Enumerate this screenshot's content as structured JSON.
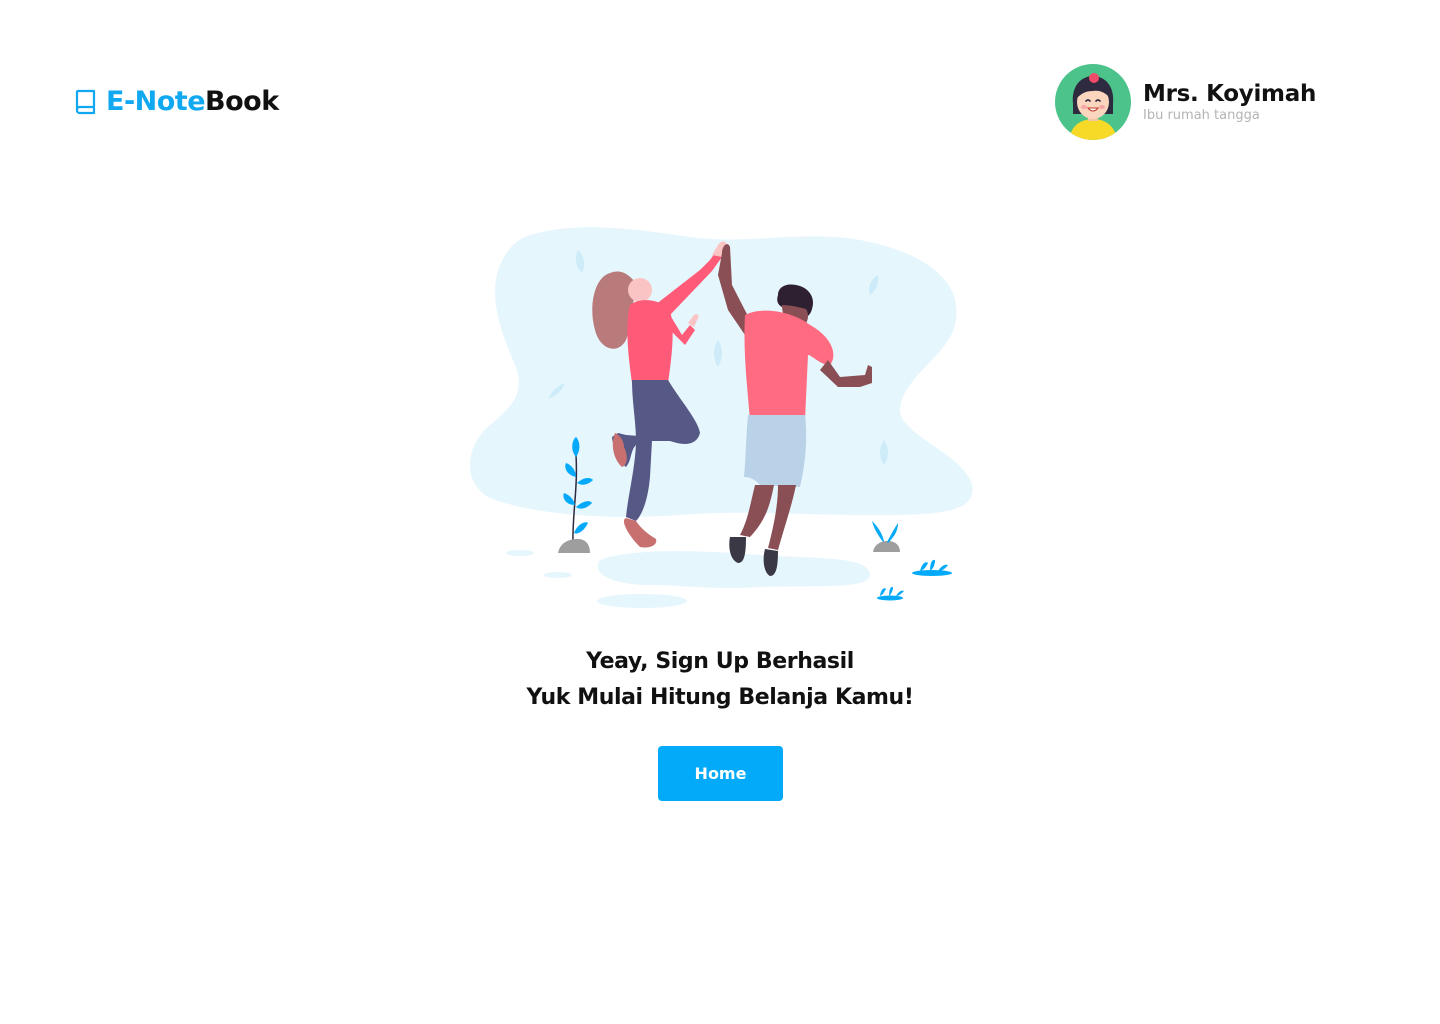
{
  "header": {
    "logo": {
      "icon": "book-icon",
      "text_part_1": "E-Note",
      "text_part_2": "Book"
    },
    "profile": {
      "name": "Mrs. Koyimah",
      "role": "Ibu rumah tangga",
      "avatar_icon": "avatar-woman-icon"
    }
  },
  "main": {
    "illustration": "high-five-people-illustration",
    "message_line_1": "Yeay, Sign Up Berhasil",
    "message_line_2": "Yuk Mulai Hitung Belanja Kamu!",
    "home_button_label": "Home"
  },
  "colors": {
    "brand": "#03aaf9",
    "text": "#111111",
    "muted": "#b4b4b4",
    "illustration_bg": "#e6f6fd",
    "shirt": "#ff6b81"
  }
}
